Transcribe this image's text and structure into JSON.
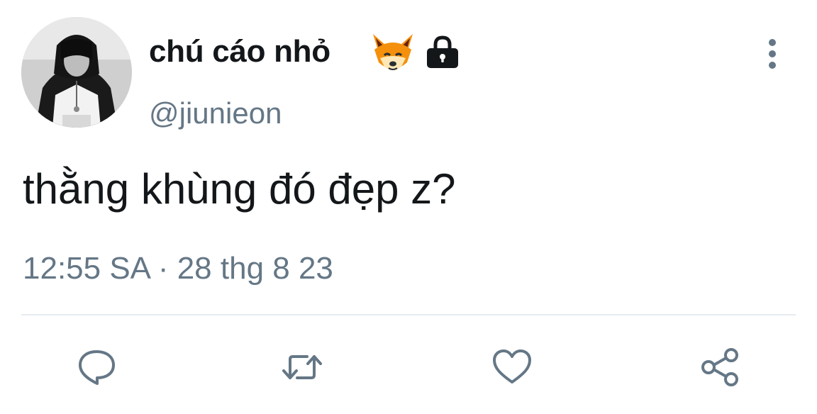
{
  "tweet": {
    "author": {
      "display_name": "chú cáo nhỏ",
      "name_emoji": "fox-face-emoji",
      "protected_icon": "lock-icon",
      "handle": "@jiunieon"
    },
    "text": "thằng khùng đó đẹp z?",
    "meta": "12:55 SA · 28 thg 8 23",
    "actions": {
      "reply": "reply-icon",
      "retweet": "retweet-icon",
      "like": "heart-icon",
      "share": "share-icon"
    },
    "more": "more-vertical-icon"
  },
  "colors": {
    "text": "#14171a",
    "secondary": "#657786",
    "divider": "#e6ecf0",
    "fox": "#f4900c"
  }
}
